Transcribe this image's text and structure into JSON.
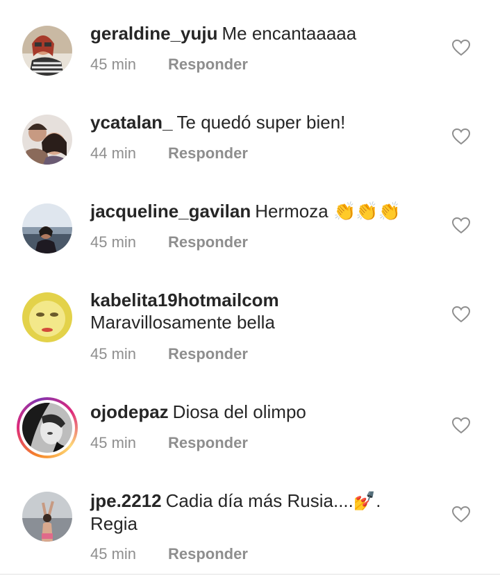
{
  "comments": [
    {
      "username": "geraldine_yuju",
      "text": "Me encantaaaaa",
      "emoji": "",
      "time": "45 min",
      "reply": "Responder",
      "icon": "heart-outline"
    },
    {
      "username": "ycatalan_",
      "text": "Te quedó super bien!",
      "emoji": "",
      "time": "44 min",
      "reply": "Responder",
      "icon": "heart-outline"
    },
    {
      "username": "jacqueline_gavilan",
      "text": "Hermoza",
      "emoji": "👏👏👏",
      "time": "45 min",
      "reply": "Responder",
      "icon": "heart-outline"
    },
    {
      "username": "kabelita19hotmailcom",
      "text": "Maravillosamente bella",
      "emoji": "",
      "time": "45 min",
      "reply": "Responder",
      "icon": "heart-outline"
    },
    {
      "username": "ojodepaz",
      "text": "Diosa del olimpo",
      "emoji": "",
      "time": "45 min",
      "reply": "Responder",
      "icon": "heart-outline"
    },
    {
      "username": "jpe.2212",
      "text": "Cadia día más Rusia....",
      "emoji": "💅",
      "text_after": ". Regia",
      "time": "45 min",
      "reply": "Responder",
      "icon": "heart-outline"
    }
  ],
  "colors": {
    "text": "#262626",
    "muted": "#8e8e8e",
    "story_ring": "#dd2a7b"
  }
}
